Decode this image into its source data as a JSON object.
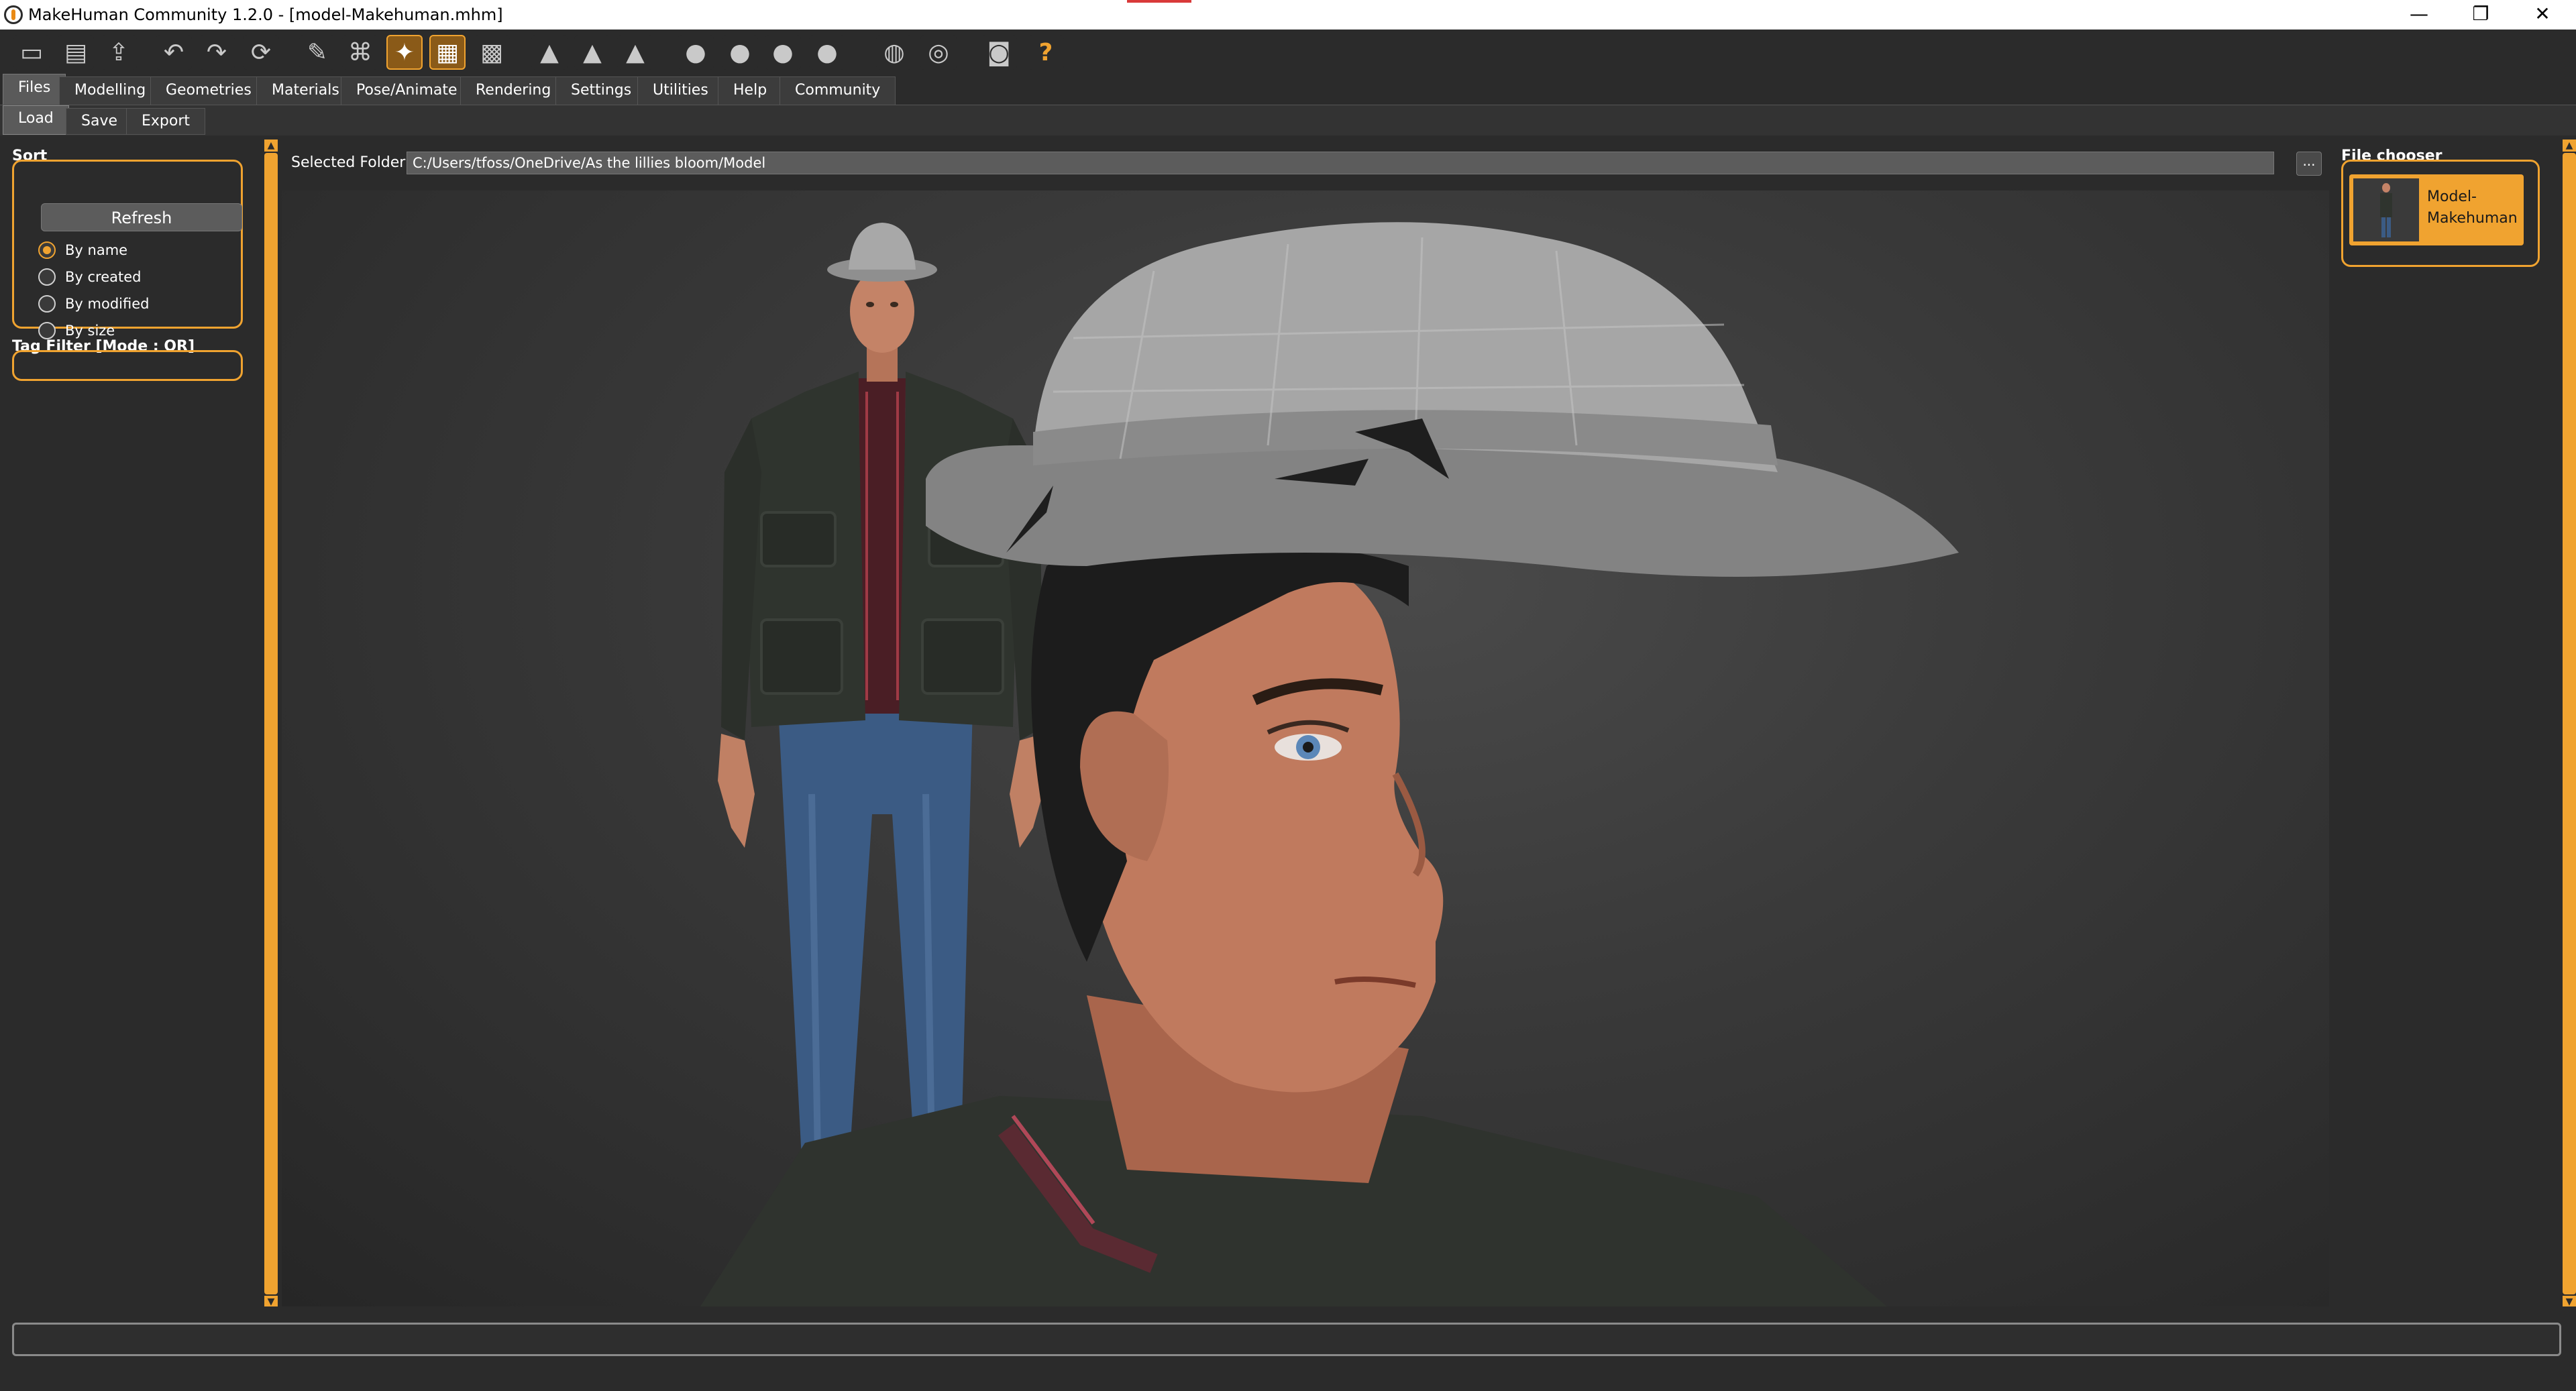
{
  "window": {
    "title": "MakeHuman Community 1.2.0 - [model-Makehuman.mhm]",
    "minimize": "—",
    "maximize": "❐",
    "close": "✕"
  },
  "toolbar": {
    "buttons": [
      {
        "name": "new-icon",
        "glyph": "▭"
      },
      {
        "name": "save-icon",
        "glyph": "▤"
      },
      {
        "name": "export-icon",
        "glyph": "⇪"
      },
      {
        "name": "undo-icon",
        "glyph": "↶"
      },
      {
        "name": "redo-icon",
        "glyph": "↷"
      },
      {
        "name": "reset-icon",
        "glyph": "⟳"
      },
      {
        "name": "smooth-icon",
        "glyph": "✎"
      },
      {
        "name": "wireframe-icon",
        "glyph": "⌘"
      },
      {
        "name": "pose-icon",
        "glyph": "✦"
      },
      {
        "name": "grid-icon",
        "glyph": "▦"
      },
      {
        "name": "background-icon",
        "glyph": "▩"
      },
      {
        "name": "symmetry-right-icon",
        "glyph": "▲"
      },
      {
        "name": "symmetry-left-icon",
        "glyph": "▲"
      },
      {
        "name": "symmetry-icon",
        "glyph": "▲"
      },
      {
        "name": "front-view-icon",
        "glyph": "●"
      },
      {
        "name": "back-view-icon",
        "glyph": "●"
      },
      {
        "name": "left-view-icon",
        "glyph": "●"
      },
      {
        "name": "right-view-icon",
        "glyph": "●"
      },
      {
        "name": "top-view-icon",
        "glyph": "◍"
      },
      {
        "name": "reset-camera-icon",
        "glyph": "◎"
      },
      {
        "name": "screenshot-icon",
        "glyph": "◙"
      },
      {
        "name": "help-icon",
        "glyph": "?"
      }
    ]
  },
  "main_tabs": [
    "Files",
    "Modelling",
    "Geometries",
    "Materials",
    "Pose/Animate",
    "Rendering",
    "Settings",
    "Utilities",
    "Help",
    "Community"
  ],
  "sub_tabs": [
    "Load",
    "Save",
    "Export"
  ],
  "sort": {
    "title": "Sort",
    "refresh_label": "Refresh",
    "options": [
      "By name",
      "By created",
      "By modified",
      "By size"
    ],
    "selected": "By name"
  },
  "tag_filter": {
    "title": "Tag Filter [Mode : OR]"
  },
  "folder": {
    "label": "Selected Folder:",
    "value": "C:/Users/tfoss/OneDrive/As the lillies bloom/Model",
    "browse_label": "..."
  },
  "file_chooser": {
    "title": "File chooser",
    "files": [
      {
        "name": "Model-Makehuman"
      }
    ]
  },
  "colors": {
    "accent": "#f0a330",
    "background": "#2b2b2b"
  }
}
